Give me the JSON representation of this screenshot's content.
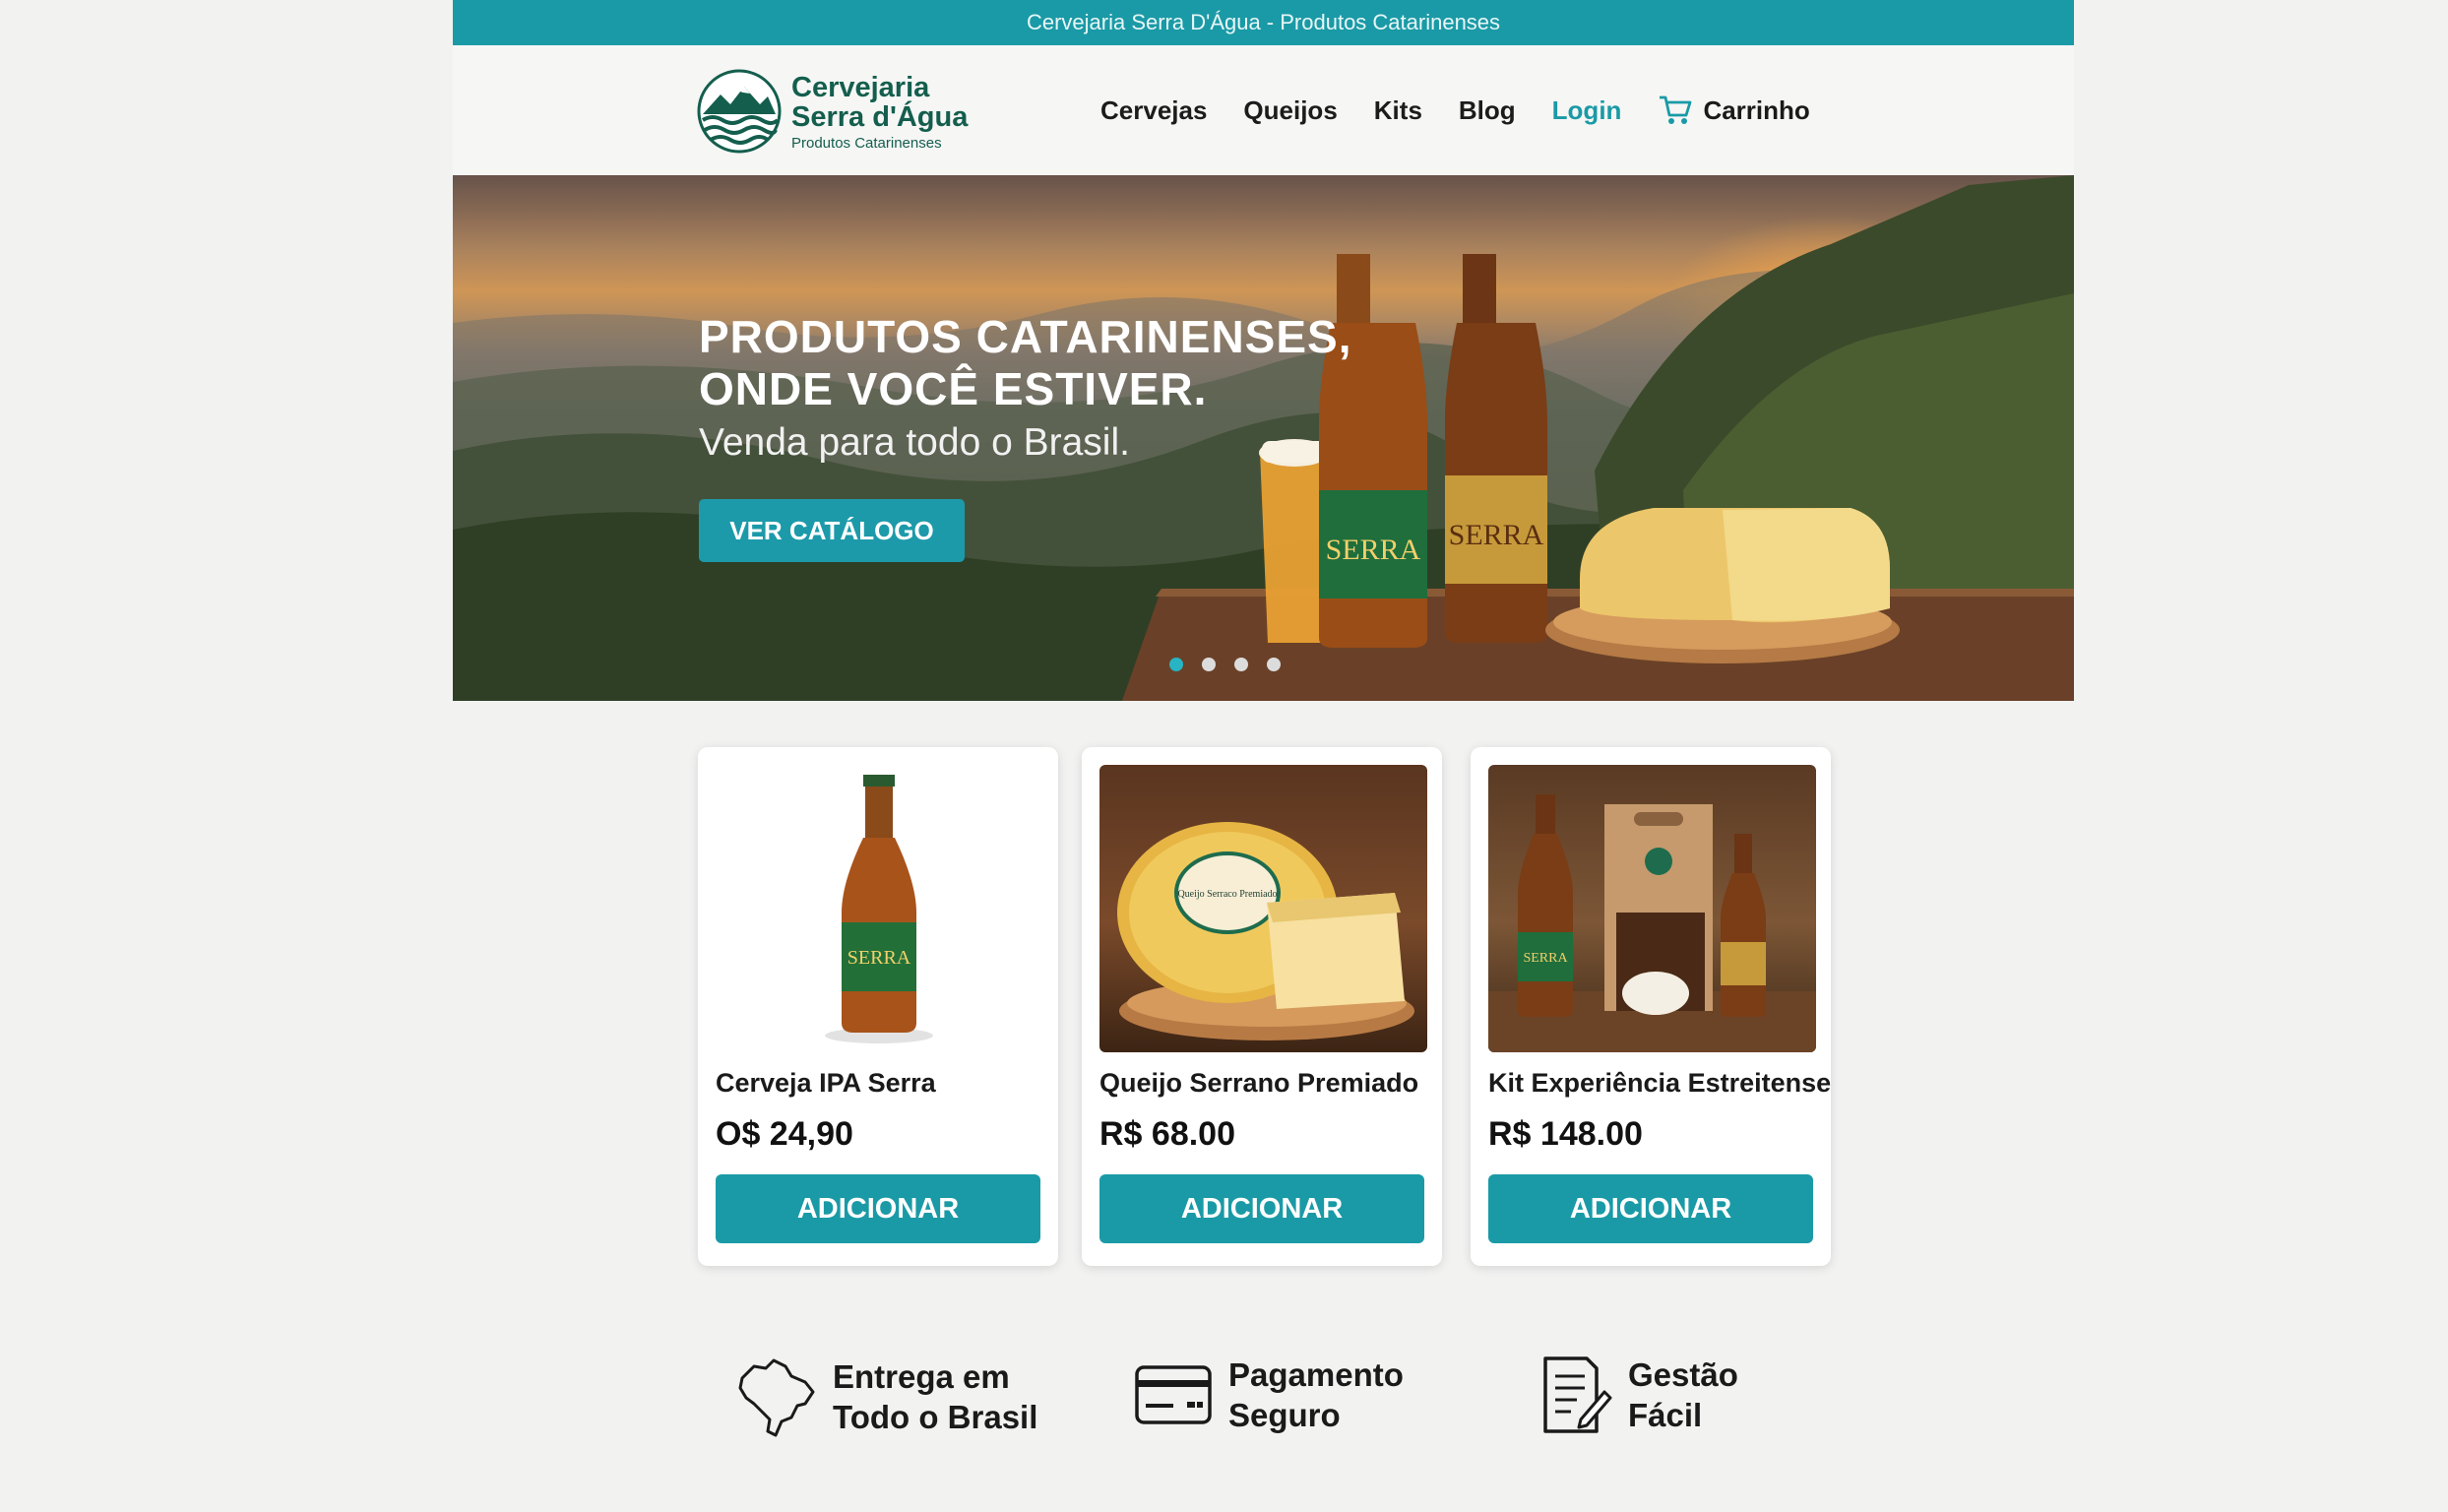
{
  "topbar": {
    "text": "Cervejaria Serra D'Água - Produtos Catarinenses"
  },
  "logo": {
    "line1": "Cervejaria",
    "line2": "Serra d'Água",
    "sub": "Produtos Catarinenses",
    "icon": "mountain-waves-logo"
  },
  "nav": {
    "items": [
      "Cervejas",
      "Queijos",
      "Kits",
      "Blog",
      "Login"
    ],
    "active": "Login",
    "cart_label": "Carrinho",
    "cart_icon": "cart-icon"
  },
  "hero": {
    "title_line1": "PRODUTOS CATARINENSES,",
    "title_line2": "ONDE VOCÊ ESTIVER.",
    "subtitle": "Venda para todo o Brasil.",
    "cta": "VER CATÁLOGO",
    "slides": 4,
    "active_slide": 1,
    "bottle_label": "SERRA"
  },
  "products": [
    {
      "name": "Cerveja IPA Serra",
      "price": "O$ 24,90",
      "button": "ADICIONAR",
      "label": "SERRA"
    },
    {
      "name": "Queijo Serrano Premiado",
      "price": "R$ 68.00",
      "button": "ADICIONAR",
      "label": "Queijo Serraco Premiado"
    },
    {
      "name": "Kit Experiência Estreitense",
      "price": "R$ 148.00",
      "button": "ADICIONAR",
      "label": "SERRA"
    }
  ],
  "features": [
    {
      "line1": "Entrega em",
      "line2": "Todo o Brasil",
      "icon": "brazil-map-icon"
    },
    {
      "line1": "Pagamento",
      "line2": "Seguro",
      "icon": "credit-card-icon"
    },
    {
      "line1": "Gestão",
      "line2": "Fácil",
      "icon": "document-edit-icon"
    }
  ],
  "colors": {
    "accent": "#1a9aa6",
    "brand_green": "#145e4d",
    "background": "#f2f2f1"
  }
}
